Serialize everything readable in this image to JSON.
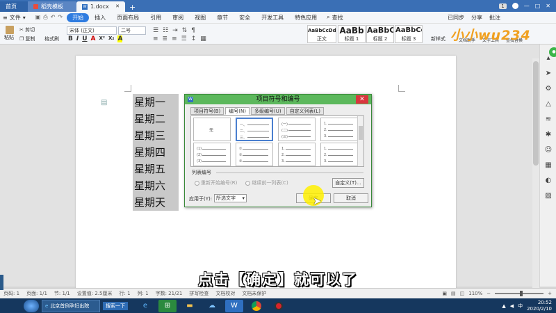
{
  "tabs": [
    {
      "label": "首页",
      "kind": "home"
    },
    {
      "label": "稻壳模板",
      "kind": "template"
    },
    {
      "label": "1.docx",
      "kind": "document"
    }
  ],
  "tab_bar": {
    "badge": "1",
    "plus": "+"
  },
  "menu": {
    "file": "文件",
    "items": [
      "开始",
      "插入",
      "页面布局",
      "引用",
      "审阅",
      "视图",
      "章节",
      "安全",
      "开发工具",
      "特色应用"
    ],
    "active": "开始",
    "search": "查找",
    "right": [
      "已同步",
      "分享",
      "批注"
    ]
  },
  "ribbon": {
    "paste": "粘贴",
    "cut": "剪切",
    "copy": "复制",
    "format_painter": "格式刷",
    "font_name": "宋体 (正文)",
    "font_size": "二号",
    "format_buttons": [
      "B",
      "I",
      "U",
      "A",
      "X²",
      "X₂",
      "A"
    ],
    "styles": [
      {
        "preview": "AaBbCcDd",
        "name": "正文"
      },
      {
        "preview": "AaBb",
        "name": "标题 1"
      },
      {
        "preview": "AaBbC",
        "name": "标题 2"
      },
      {
        "preview": "AaBbCc",
        "name": "标题 3"
      }
    ],
    "new_style": "新样式",
    "right_tools": [
      "文档助手",
      "文字工具",
      "查找替换"
    ],
    "watermark": "小小wu234"
  },
  "document": {
    "lines": [
      "星期一",
      "星期二",
      "星期三",
      "星期四",
      "星期五",
      "星期六",
      "星期天"
    ]
  },
  "dialog": {
    "title": "项目符号和编号",
    "tabs": [
      "项目符号(B)",
      "编号(N)",
      "多级编号(U)",
      "自定义列表(L)"
    ],
    "active_tab": "编号(N)",
    "gallery": [
      {
        "labels": [
          "无"
        ]
      },
      {
        "labels": [
          "一、",
          "二、",
          "三、"
        ]
      },
      {
        "labels": [
          "(一)",
          "(二)",
          "(三)"
        ]
      },
      {
        "labels": [
          "1.",
          "2.",
          "3."
        ]
      },
      {
        "labels": [
          "(1)",
          "(2)",
          "(3)"
        ]
      },
      {
        "labels": [
          "①",
          "②",
          "③"
        ]
      },
      {
        "labels": [
          "1.",
          "2.",
          "3."
        ]
      },
      {
        "labels": [
          "1.",
          "2.",
          "3."
        ]
      }
    ],
    "list_number_section": "列表编号",
    "radio_restart": "重新开始编号(R)",
    "radio_continue": "继续前一列表(C)",
    "customize_button": "自定义(T)...",
    "apply_label": "应用于(Y):",
    "apply_value": "所选文字",
    "ok_button": "确定",
    "cancel_button": "取消"
  },
  "subtitle": "点击【确定】就可以了",
  "status": {
    "page_num": "页码: 1",
    "page": "页面: 1/1",
    "section": "节: 1/1",
    "position": "设置值: 2.5厘米",
    "line": "行: 1",
    "col": "列: 1",
    "words": "字数: 21/21",
    "spell": "拼写检查",
    "proofread": "文档校对",
    "protect": "文档未保护",
    "zoom": "110%"
  },
  "taskbar": {
    "browser_title": "北京首例孕妇出院",
    "search": "搜索一下",
    "tray_lang": "中",
    "time": "20:52",
    "date": "2020/2/10"
  },
  "colors": {
    "tab_bar": "#3a6fb5",
    "dialog_title": "#5cb85c",
    "active_menu": "#2f7ce0",
    "taskbar": "#15375e"
  }
}
